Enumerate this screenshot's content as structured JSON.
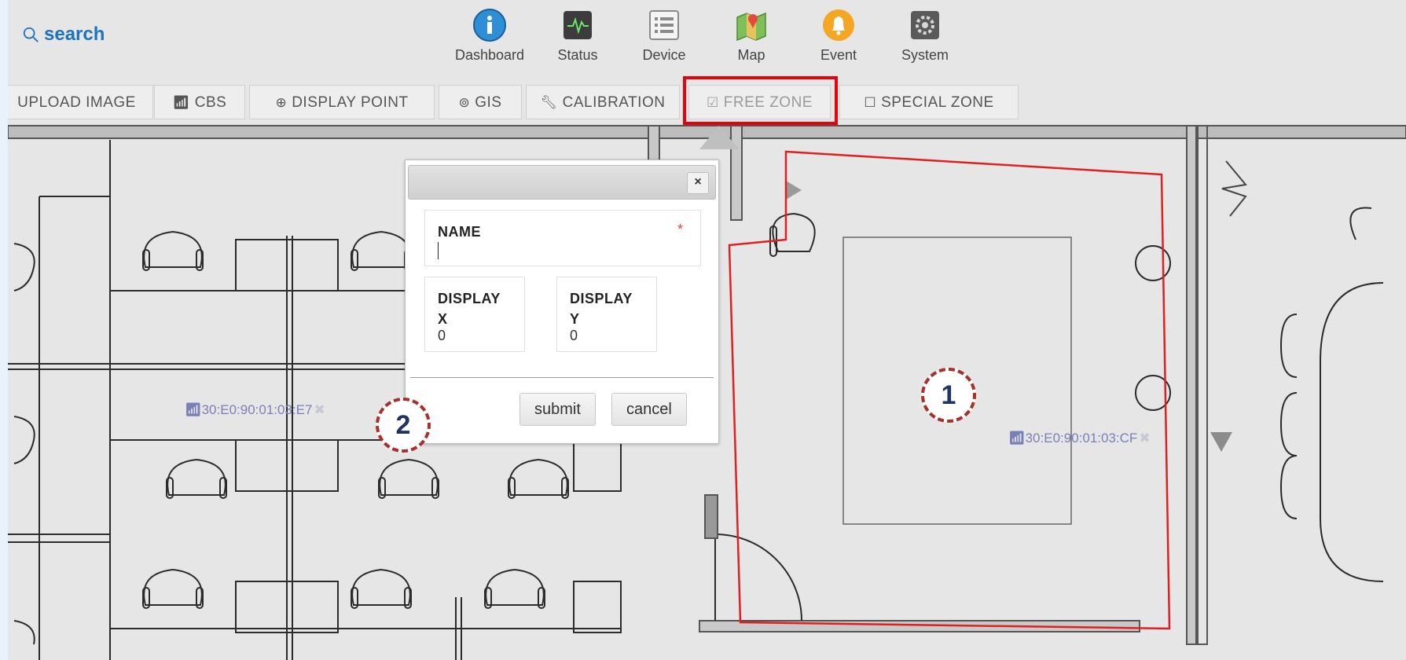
{
  "search": {
    "label": "search"
  },
  "nav": [
    {
      "label": "Dashboard",
      "icon": "info-icon"
    },
    {
      "label": "Status",
      "icon": "monitor-icon"
    },
    {
      "label": "Device",
      "icon": "list-icon"
    },
    {
      "label": "Map",
      "icon": "map-icon"
    },
    {
      "label": "Event",
      "icon": "bell-icon"
    },
    {
      "label": "System",
      "icon": "gear-icon"
    }
  ],
  "toolbar": {
    "upload_image": "UPLOAD IMAGE",
    "cbs": "CBS",
    "display_point": "DISPLAY POINT",
    "gis": "GIS",
    "calibration": "CALIBRATION",
    "free_zone": "FREE ZONE",
    "special_zone": "SPECIAL ZONE"
  },
  "dialog": {
    "name_label": "NAME",
    "required_mark": "*",
    "name_value": "",
    "display_x_label": "DISPLAY X",
    "display_x_value": "0",
    "display_y_label": "DISPLAY Y",
    "display_y_value": "0",
    "submit": "submit",
    "cancel": "cancel",
    "close": "×"
  },
  "access_points": [
    {
      "id": "30:E0:90:01:03:E7"
    },
    {
      "id": "30:E0:90:01:03:CF"
    }
  ],
  "markers": [
    "1",
    "2"
  ],
  "colors": {
    "accent_blue": "#1e73be",
    "highlight_red": "#e8000b",
    "zone_red": "#e02020",
    "marker_border": "#a8302b",
    "marker_text": "#1f3461"
  }
}
